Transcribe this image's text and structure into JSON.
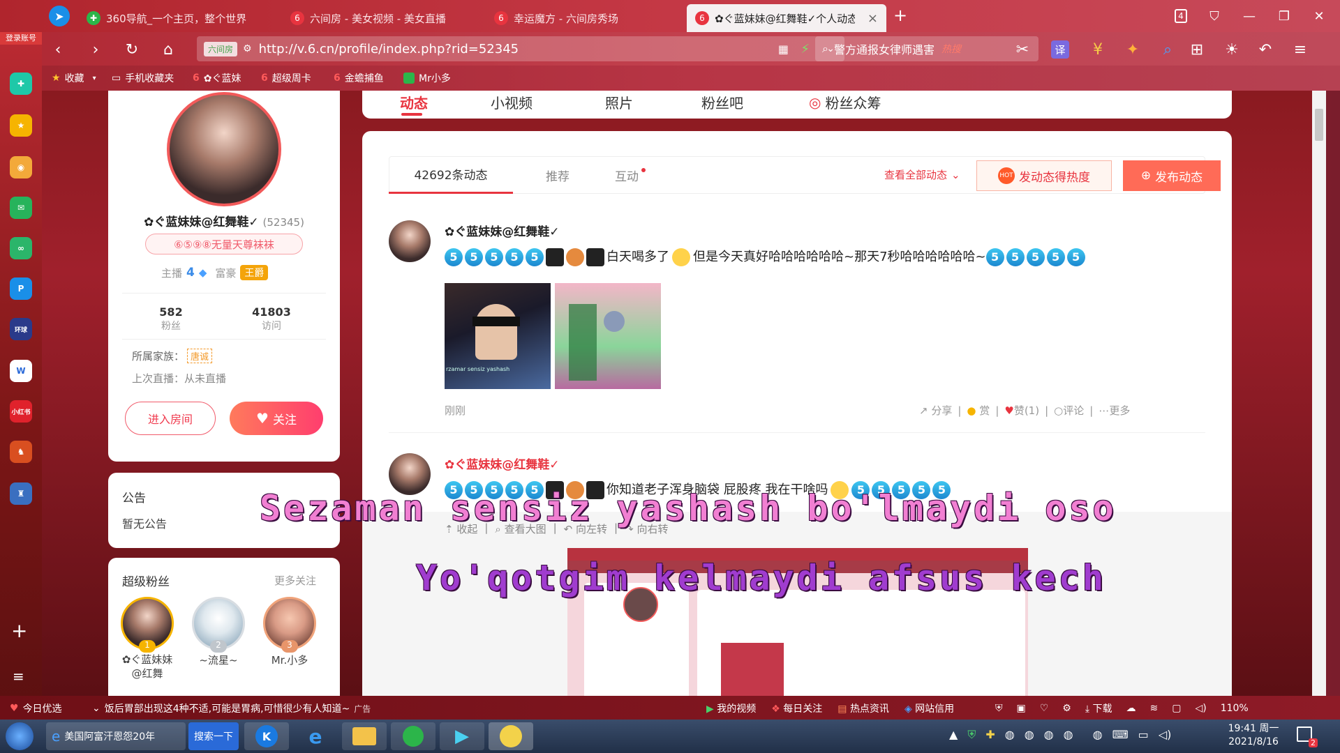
{
  "browser": {
    "brand_label": "登录账号",
    "tabs": [
      {
        "label": "360导航_一个主页，整个世界",
        "icon": "360-icon",
        "active": false
      },
      {
        "label": "六间房 - 美女视频 - 美女直播",
        "icon": "six-icon",
        "active": false
      },
      {
        "label": "幸运魔方 - 六间房秀场",
        "icon": "six-icon",
        "active": false
      },
      {
        "label": "✿ぐ蓝妹妹@红舞鞋✓个人动态",
        "icon": "six-icon",
        "active": true
      }
    ],
    "tab_count": "4",
    "url_site_label": "六间房",
    "url": "http://v.6.cn/profile/index.php?rid=52345",
    "search_text": "警方通报女律师遇害",
    "search_hot": "热搜",
    "translate": "译",
    "bookmarks": [
      {
        "label": "收藏",
        "icon": "star-icon"
      },
      {
        "label": "手机收藏夹",
        "icon": "folder-icon"
      },
      {
        "label": "✿ぐ蓝妹",
        "icon": "six-icon"
      },
      {
        "label": "超级周卡",
        "icon": "six-icon"
      },
      {
        "label": "金蟾捕鱼",
        "icon": "six-icon"
      },
      {
        "label": "Mr小多",
        "icon": "green-icon"
      }
    ]
  },
  "profile": {
    "nav_tabs": [
      "动态",
      "小视频",
      "照片",
      "粉丝吧",
      "粉丝众筹"
    ],
    "name": "✿ぐ蓝妹妹@红舞鞋✓",
    "rid": "(52345)",
    "badge": "⑥⑤⑨⑧无量天尊袜袜",
    "anchor_label": "主播",
    "anchor_level": "4",
    "rich_label": "富豪",
    "rich_level": "王爵",
    "fans_count": "582",
    "fans_label": "粉丝",
    "visits_count": "41803",
    "visits_label": "访问",
    "family_label": "所属家族：",
    "family_value": "唐诚",
    "last_live": "上次直播：从未直播",
    "enter_room": "进入房间",
    "follow": "关注"
  },
  "notice": {
    "title": "公告",
    "text": "暂无公告"
  },
  "super_fans": {
    "title": "超级粉丝",
    "more": "更多关注",
    "fans": [
      {
        "rank": "1",
        "name": "✿ぐ蓝妹妹@红舞"
      },
      {
        "rank": "2",
        "name": "~流星~"
      },
      {
        "rank": "3",
        "name": "Mr.小多"
      }
    ]
  },
  "feed": {
    "tabs": [
      "42692条动态",
      "推荐",
      "互动"
    ],
    "view_all": "查看全部动态",
    "hot_button": "发动态得热度",
    "post_button": "发布动态",
    "posts": [
      {
        "author": "✿ぐ蓝妹妹@红舞鞋✓",
        "text1": "白天喝多了",
        "text2": "但是今天真好哈哈哈哈哈哈~那天7秒哈哈哈哈哈哈~",
        "time": "刚刚",
        "actions": [
          "分享",
          "赏",
          "赞(1)",
          "评论",
          "更多"
        ]
      },
      {
        "author": "✿ぐ蓝妹妹@红舞鞋✓",
        "text1": "你知道老子浑身脑袋 屁股疼 我在干啥吗",
        "image_tools": [
          "收起",
          "查看大图",
          "向左转",
          "向右转"
        ]
      }
    ],
    "thumb_caption": "rzamar sensiz yashash"
  },
  "subtitles": {
    "line1": "Sezaman sensiz yashash bo'lmaydi oso",
    "line2": "Yo'qotgim kelmaydi afsus kech"
  },
  "statusbar": {
    "today": "今日优选",
    "news": "饭后胃部出现这4种不适,可能是胃病,可惜很少有人知道~",
    "ad": "广告",
    "items": [
      "我的视频",
      "每日关注",
      "热点资讯",
      "网站信用"
    ],
    "download": "下载",
    "zoom": "110%"
  },
  "taskbar": {
    "ie_title": "美国阿富汗恩怨20年",
    "search_btn": "搜索一下",
    "time": "19:41 周一",
    "date": "2021/8/16",
    "badge": "2"
  },
  "colors": {
    "accent": "#ff3e6e",
    "tab_active_underline": "#e8343f",
    "link_red": "#e8343f"
  }
}
